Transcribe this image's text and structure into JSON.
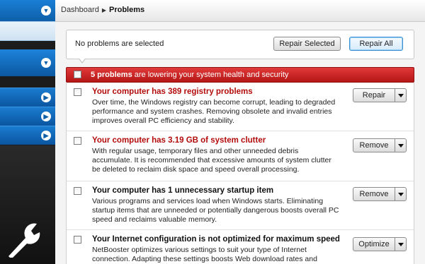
{
  "breadcrumb": {
    "parent": "Dashboard",
    "current": "Problems"
  },
  "toolbar": {
    "status_text": "No problems are selected",
    "repair_selected_label": "Repair Selected",
    "repair_all_label": "Repair All"
  },
  "banner": {
    "count_text": "5 problems",
    "rest_text": " are lowering your system health and security"
  },
  "problems": [
    {
      "title": "Your computer has 389 registry problems",
      "description": "Over time, the Windows registry can become corrupt, leading to degraded performance and system crashes. Removing obsolete and invalid entries improves overall PC efficiency and stability.",
      "action": "Repair"
    },
    {
      "title": "Your computer has 3.19 GB of system clutter",
      "description": "With regular usage, temporary files and other unneeded debris accumulate. It is recommended that excessive amounts of system clutter be deleted to reclaim disk space and speed overall processing.",
      "action": "Remove"
    },
    {
      "title": "Your computer has 1 unnecessary startup item",
      "description": "Various programs and services load when Windows starts. Eliminating startup items that are unneeded or potentially dangerous boosts overall PC speed and reclaims valuable memory.",
      "action": "Remove"
    },
    {
      "title": "Your Internet configuration is not optimized for maximum speed",
      "description": "NetBooster optimizes various settings to suit your type of Internet connection. Adapting these settings boosts Web download rates and",
      "action": "Optimize"
    }
  ],
  "colors": {
    "accent": "#0d5fa8",
    "alert": "#c21a1a",
    "title_red": "#b40c0c"
  }
}
